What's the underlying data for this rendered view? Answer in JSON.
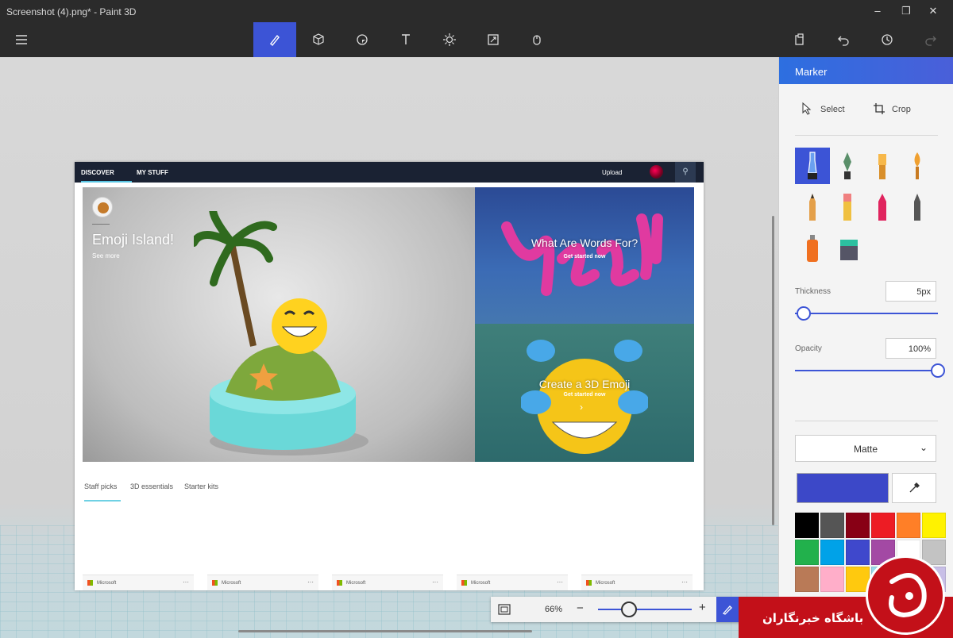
{
  "window": {
    "title": "Screenshot (4).png* - Paint 3D"
  },
  "toolbar": {
    "tools": [
      "brushes-icon",
      "3d-shapes-icon",
      "stickers-icon",
      "text-icon",
      "effects-icon",
      "canvas-icon",
      "3d-library-icon"
    ],
    "active": "brushes-icon"
  },
  "embedded": {
    "nav": {
      "discover": "DISCOVER",
      "my_stuff": "MY STUFF",
      "upload": "Upload"
    },
    "hero": {
      "title": "Emoji Island!",
      "link": "See more"
    },
    "tile1": {
      "title": "What Are Words For?",
      "sub": "Get started now"
    },
    "tile2": {
      "title": "Create a 3D Emoji",
      "sub": "Get started now"
    },
    "tabs": [
      "Staff picks",
      "3D essentials",
      "Starter kits"
    ],
    "cards": [
      "Microsoft",
      "Microsoft",
      "Microsoft",
      "Microsoft",
      "Microsoft"
    ],
    "card_more": "···"
  },
  "zoom": {
    "value": "66%",
    "level": 0.33,
    "minus": "−",
    "plus": "+"
  },
  "panel": {
    "title": "Marker",
    "select": "Select",
    "crop": "Crop",
    "thickness_label": "Thickness",
    "thickness_value": "5px",
    "thickness_level": 0.06,
    "opacity_label": "Opacity",
    "opacity_value": "100%",
    "opacity_level": 1.0,
    "finish": "Matte",
    "selected_color": "#3c48c8",
    "brushes": [
      "marker",
      "calligraphy-pen",
      "oil-brush",
      "watercolor",
      "pencil",
      "eraser",
      "crayon",
      "pixel-pen",
      "spray-can",
      "fill"
    ],
    "palette": [
      "#000000",
      "#555555",
      "#880015",
      "#ed1c24",
      "#ff7f27",
      "#fff200",
      "#22b14c",
      "#00a2e8",
      "#3f48cc",
      "#a349a4",
      "#ffffff",
      "#c3c3c3",
      "#b97a57",
      "#ffaec9",
      "#ffc90e",
      "#99d9ea",
      "#7092be",
      "#c8bfe7"
    ]
  },
  "watermark": {
    "text": "باشگاه خبرنگاران"
  },
  "colors": {
    "accent": "#3c54d6",
    "chrome": "#2b2b2b",
    "brand_red": "#c31019"
  }
}
